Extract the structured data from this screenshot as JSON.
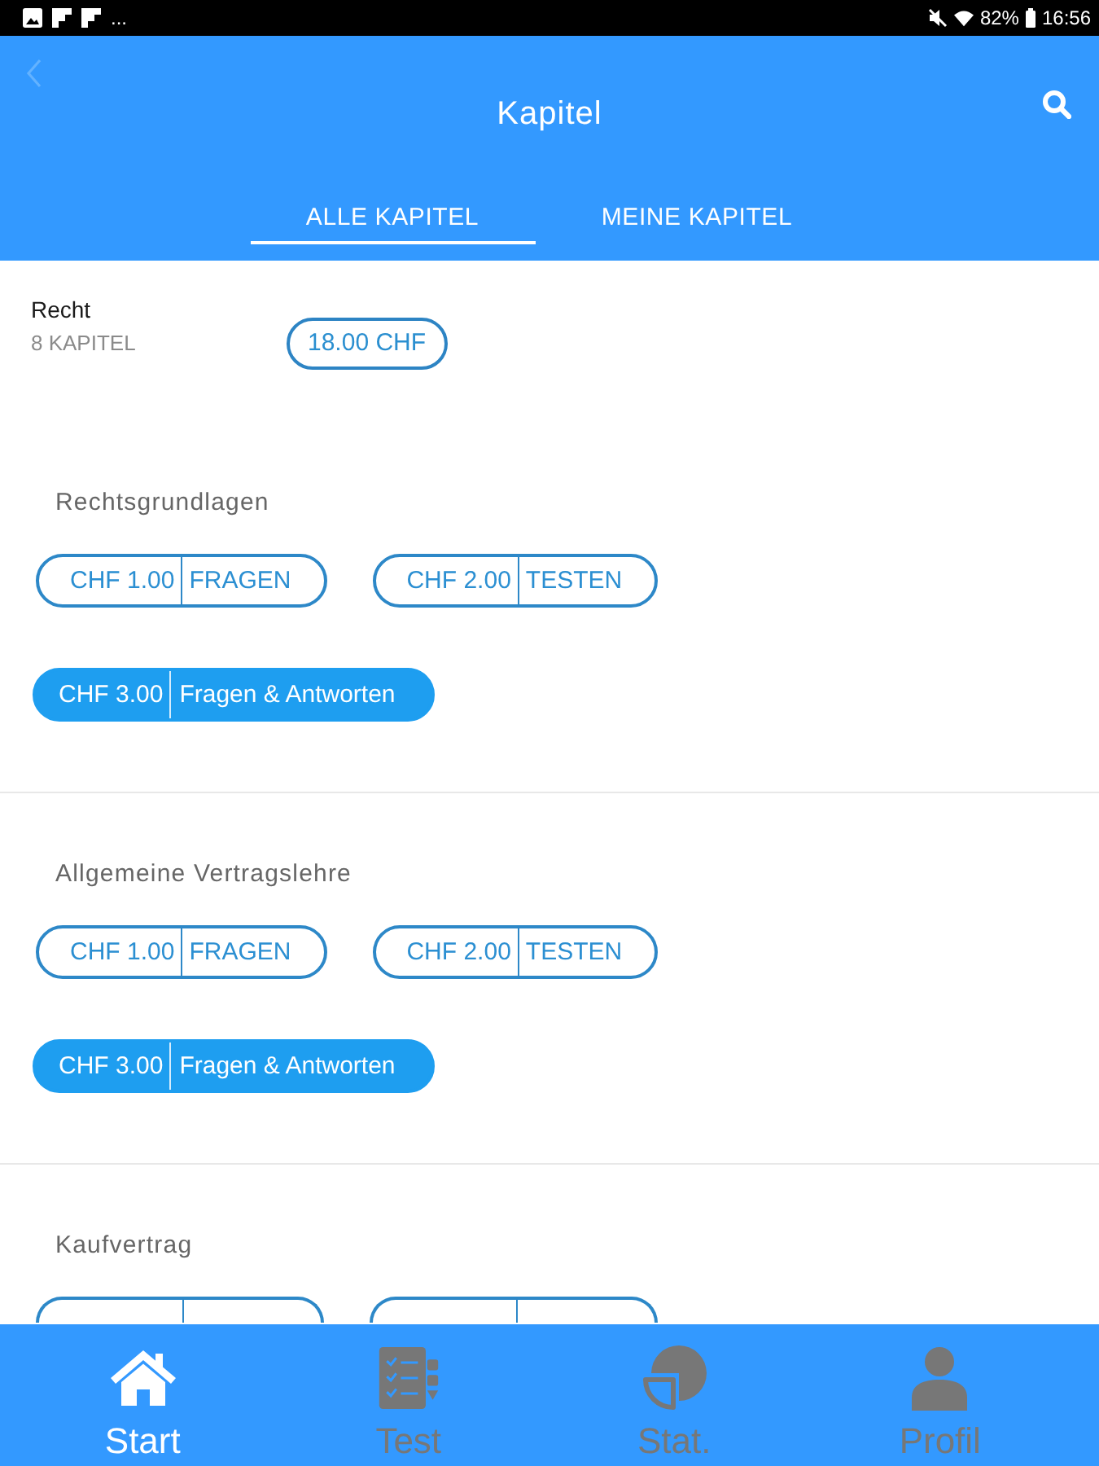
{
  "status_bar": {
    "overflow": "...",
    "battery": "82%",
    "time": "16:56"
  },
  "header": {
    "title": "Kapitel",
    "back": {
      "disabled": true
    }
  },
  "tabs": [
    {
      "label": "ALLE KAPITEL",
      "selected": true
    },
    {
      "label": "MEINE KAPITEL",
      "selected": false
    }
  ],
  "course": {
    "name": "Recht",
    "count": "8 KAPITEL",
    "price": "18.00 CHF"
  },
  "chapters": [
    {
      "title": "Rechtsgrundlagen",
      "options": [
        {
          "kind": "outline",
          "price": "CHF 1.00",
          "label": "FRAGEN"
        },
        {
          "kind": "outline",
          "price": "CHF 2.00",
          "label": "TESTEN"
        },
        {
          "kind": "filled",
          "price": "CHF 3.00",
          "label": "Fragen & Antworten"
        }
      ]
    },
    {
      "title": "Allgemeine Vertragslehre",
      "options": [
        {
          "kind": "outline",
          "price": "CHF 1.00",
          "label": "FRAGEN"
        },
        {
          "kind": "outline",
          "price": "CHF 2.00",
          "label": "TESTEN"
        },
        {
          "kind": "filled",
          "price": "CHF 3.00",
          "label": "Fragen & Antworten"
        }
      ]
    },
    {
      "title": "Kaufvertrag",
      "options": [
        {
          "kind": "cut"
        },
        {
          "kind": "cut"
        }
      ]
    }
  ],
  "bottom_nav": [
    {
      "label": "Start",
      "selected": true
    },
    {
      "label": "Test",
      "selected": false
    },
    {
      "label": "Stat.",
      "selected": false
    },
    {
      "label": "Profil",
      "selected": false
    }
  ]
}
